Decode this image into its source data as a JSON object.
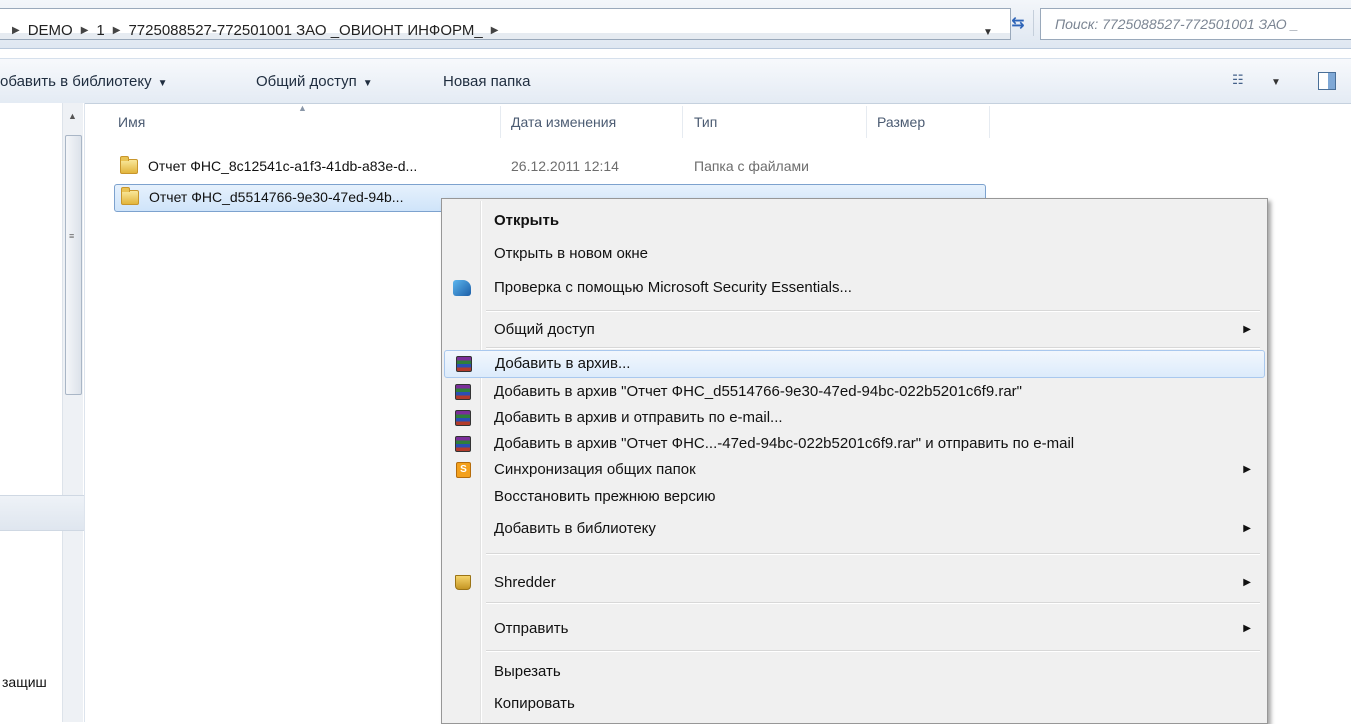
{
  "address": {
    "crumbs": [
      "DEMO",
      "1",
      "7725088527-772501001 ЗАО _ОВИОНТ ИНФОРМ_"
    ],
    "search_placeholder": "Поиск: 7725088527-772501001 ЗАО _"
  },
  "toolbar": {
    "add_to_library": "обавить в библиотеку",
    "share": "Общий доступ",
    "new_folder": "Новая папка"
  },
  "columns": {
    "name": "Имя",
    "date": "Дата изменения",
    "type": "Тип",
    "size": "Размер"
  },
  "files": [
    {
      "name": "Отчет ФНС_8c12541c-a1f3-41db-a83e-d...",
      "date": "26.12.2011 12:14",
      "type": "Папка с файлами"
    },
    {
      "name": "Отчет ФНС_d5514766-9e30-47ed-94b...",
      "date": "",
      "type": ""
    }
  ],
  "left_pane": {
    "cut_text": "защиш"
  },
  "context_menu": {
    "items": [
      {
        "label": "Открыть",
        "icon": ""
      },
      {
        "label": "Открыть в новом окне",
        "icon": ""
      },
      {
        "label": "Проверка с помощью Microsoft Security Essentials...",
        "icon": "security-essentials-icon"
      },
      {
        "label": "Общий доступ",
        "icon": ""
      },
      {
        "label": "Добавить в архив...",
        "icon": "winrar-icon"
      },
      {
        "label": "Добавить в архив \"Отчет ФНС_d5514766-9e30-47ed-94bc-022b5201c6f9.rar\"",
        "icon": "winrar-icon"
      },
      {
        "label": "Добавить в архив и отправить по e-mail...",
        "icon": "winrar-icon"
      },
      {
        "label": "Добавить в архив \"Отчет ФНС...-47ed-94bc-022b5201c6f9.rar\" и отправить по e-mail",
        "icon": "winrar-icon"
      },
      {
        "label": "Синхронизация общих папок",
        "icon": "sharepoint-sync-icon"
      },
      {
        "label": "Восстановить прежнюю версию",
        "icon": ""
      },
      {
        "label": "Добавить в библиотеку",
        "icon": ""
      },
      {
        "label": "Shredder",
        "icon": "shredder-icon"
      },
      {
        "label": "Отправить",
        "icon": ""
      },
      {
        "label": "Вырезать",
        "icon": ""
      },
      {
        "label": "Копировать",
        "icon": ""
      }
    ]
  }
}
